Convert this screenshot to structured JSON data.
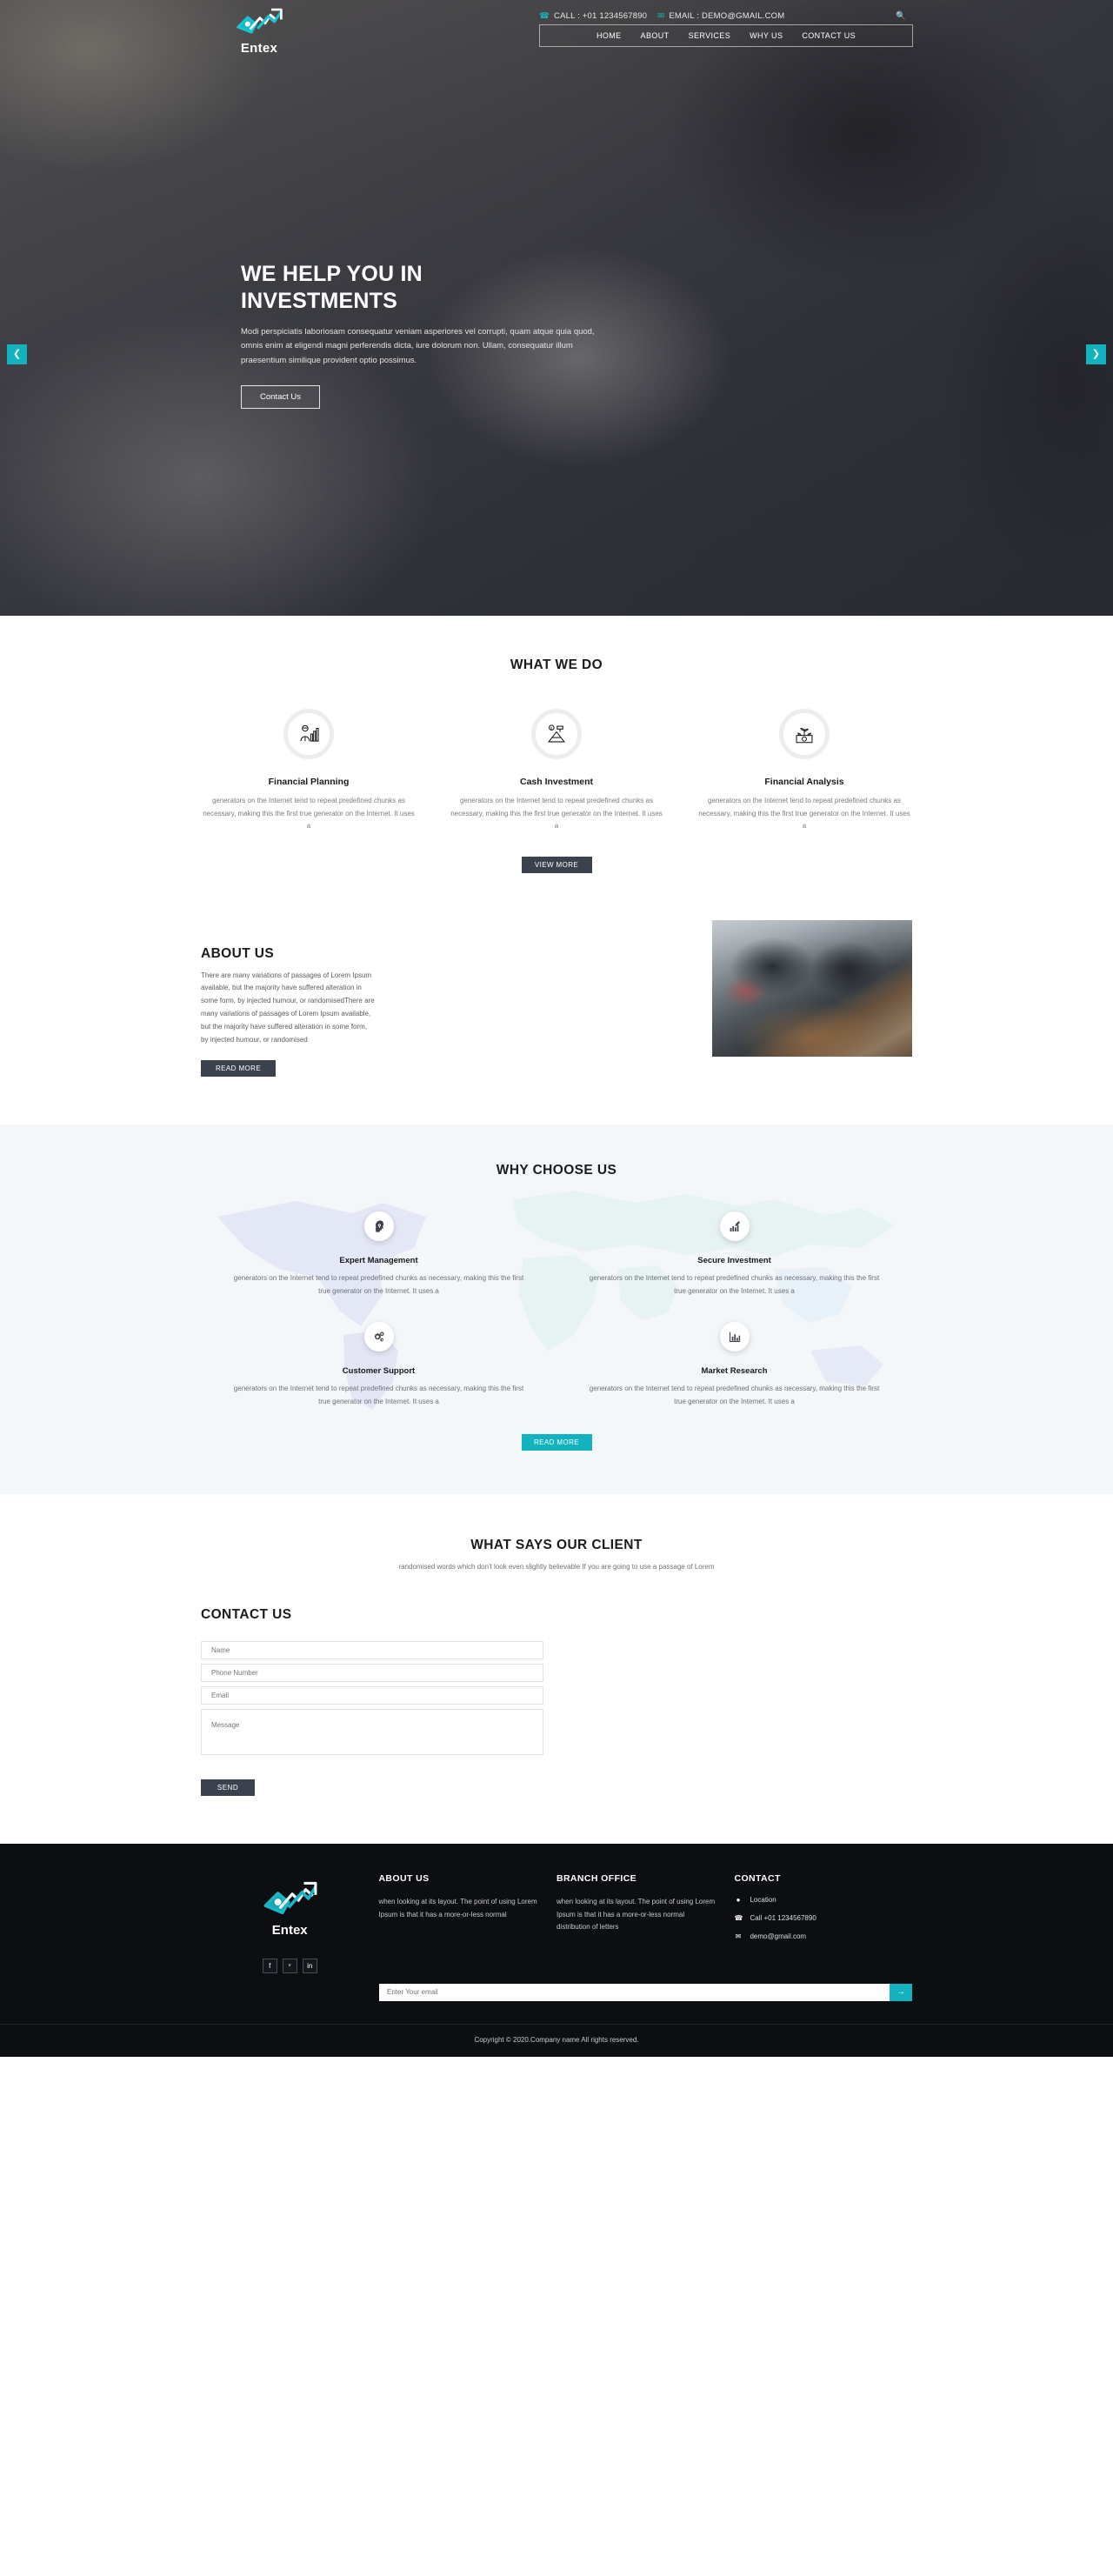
{
  "brand": {
    "name": "Entex",
    "logo_icon": "money-arrow-growth-icon"
  },
  "topbar": {
    "call_label": "CALL : +01 1234567890",
    "email_label": "EMAIL : DEMO@GMAIL.COM",
    "phone_icon": "phone-icon",
    "email_icon": "envelope-icon",
    "search_icon": "search-icon",
    "nav": [
      {
        "label": "HOME",
        "active": true
      },
      {
        "label": "ABOUT",
        "active": false
      },
      {
        "label": "SERVICES",
        "active": false
      },
      {
        "label": "WHY US",
        "active": false
      },
      {
        "label": "CONTACT US",
        "active": false
      }
    ]
  },
  "hero": {
    "title_line1": "WE HELP YOU IN",
    "title_line2": "INVESTMENTS",
    "paragraph": "Modi perspiciatis laboriosam consequatur veniam asperiores vel corrupti, quam atque quia quod, omnis enim at eligendi magni perferendis dicta, iure dolorum non. Ullam, consequatur illum praesentium similique provident optio possimus.",
    "cta_label": "Contact Us",
    "prev_icon": "chevron-left-icon",
    "next_icon": "chevron-right-icon"
  },
  "services": {
    "title": "WHAT WE DO",
    "body": "generators on the Internet tend to repeat predefined chunks as necessary, making this the first true generator on the Internet. It uses a",
    "items": [
      {
        "title": "Financial Planning",
        "icon": "analyst-chart-icon"
      },
      {
        "title": "Cash Investment",
        "icon": "money-pyramid-icon"
      },
      {
        "title": "Financial Analysis",
        "icon": "money-plant-growth-icon"
      }
    ],
    "button_label": "VIEW MORE"
  },
  "about": {
    "title": "ABOUT US",
    "paragraph": "There are many variations of passages of Lorem Ipsum available, but the majority have suffered alteration in some form, by injected humour, or randomisedThere are many variations of passages of Lorem Ipsum available, but the majority have suffered alteration in some form, by injected humour, or randomised",
    "button_label": "READ MORE",
    "image_alt": "team-meeting-photo"
  },
  "why": {
    "title": "WHY CHOOSE US",
    "body": "generators on the Internet tend to repeat predefined chunks as necessary, making this the first true generator on the Internet. It uses a",
    "items": [
      {
        "title": "Expert Management",
        "icon": "brain-head-icon"
      },
      {
        "title": "Secure Investment",
        "icon": "pen-chart-icon"
      },
      {
        "title": "Customer Support",
        "icon": "gears-icon"
      },
      {
        "title": "Market Research",
        "icon": "bar-chart-icon"
      }
    ],
    "button_label": "READ MORE"
  },
  "testimonial": {
    "title": "WHAT SAYS OUR CLIENT",
    "subtitle": "randomised words which don't look even slightly believable If you are going to use a passage of Lorem"
  },
  "contact": {
    "title": "CONTACT US",
    "fields": {
      "name_placeholder": "Name",
      "phone_placeholder": "Phone Number",
      "email_placeholder": "Email",
      "message_placeholder": "Message"
    },
    "submit_label": "SEND"
  },
  "footer": {
    "about": {
      "title": "ABOUT US",
      "text": "when looking at its layout. The point of using Lorem Ipsum is that it has a more-or-less normal"
    },
    "branch": {
      "title": "BRANCH OFFICE",
      "text": "when looking at its layout. The point of using Lorem Ipsum is that it has a more-or-less normal distribution of letters"
    },
    "contact": {
      "title": "CONTACT",
      "items": [
        {
          "icon": "map-pin-icon",
          "label": "Location"
        },
        {
          "icon": "phone-icon",
          "label": "Call +01 1234567890"
        },
        {
          "icon": "envelope-icon",
          "label": "demo@gmail.com"
        }
      ]
    },
    "socials": [
      {
        "icon": "facebook-icon",
        "glyph": "f"
      },
      {
        "icon": "twitter-icon",
        "glyph": "ᵛ"
      },
      {
        "icon": "linkedin-icon",
        "glyph": "in"
      }
    ],
    "newsletter": {
      "placeholder": "Enter Your email",
      "button_icon": "arrow-right-icon",
      "button_glyph": "→"
    },
    "copyright": "Copyright © 2020.Company name All rights reserved."
  },
  "colors": {
    "accent": "#12b2be",
    "dark": "#3b424d",
    "footer_bg": "#0d0e12",
    "section_bg": "#f4f7fa"
  }
}
